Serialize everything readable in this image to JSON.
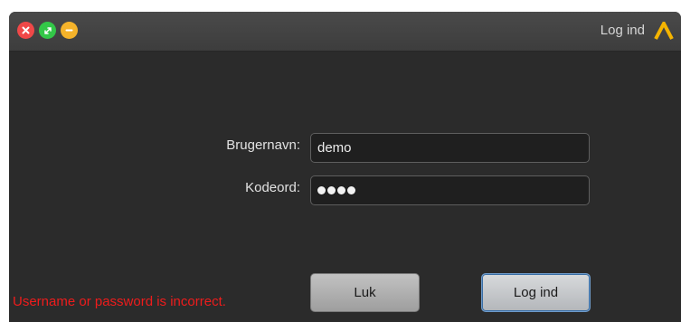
{
  "window": {
    "title": "Log ind"
  },
  "titlebar": {
    "buttons": [
      {
        "name": "close",
        "icon": "close-icon",
        "color": "#f04848"
      },
      {
        "name": "maximize",
        "icon": "expand-icon",
        "color": "#33c748"
      },
      {
        "name": "minimize",
        "icon": "minimize-icon",
        "color": "#f5b32a"
      }
    ],
    "logo_icon": "app-logo-chevron",
    "logo_color": "#f5b400"
  },
  "form": {
    "username_label": "Brugernavn:",
    "username_value": "demo",
    "password_label": "Kodeord:",
    "password_length": 4
  },
  "status": {
    "error_message": "Username or password is incorrect.",
    "error_color": "#ee1c1c"
  },
  "actions": {
    "close_label": "Luk",
    "login_label": "Log ind"
  }
}
